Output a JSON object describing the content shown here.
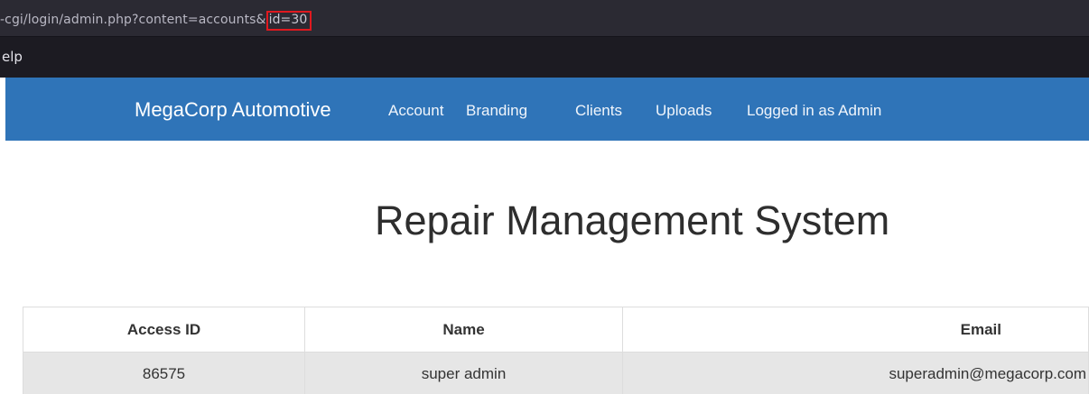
{
  "browser": {
    "url_prefix": "-cgi/login/admin.php?content=accounts&",
    "url_highlight": "id=30",
    "menu_item": "elp"
  },
  "navbar": {
    "brand": "MegaCorp Automotive",
    "links": [
      "Account",
      "Branding",
      "Clients",
      "Uploads",
      "Logged in as Admin"
    ]
  },
  "page": {
    "title": "Repair Management System"
  },
  "table": {
    "headers": [
      "Access ID",
      "Name",
      "Email"
    ],
    "rows": [
      [
        "86575",
        "super admin",
        "superadmin@megacorp.com"
      ]
    ]
  },
  "colors": {
    "navbar": "#2f74b8",
    "highlight_box": "#e0191f",
    "row_background": "#e6e6e6"
  }
}
